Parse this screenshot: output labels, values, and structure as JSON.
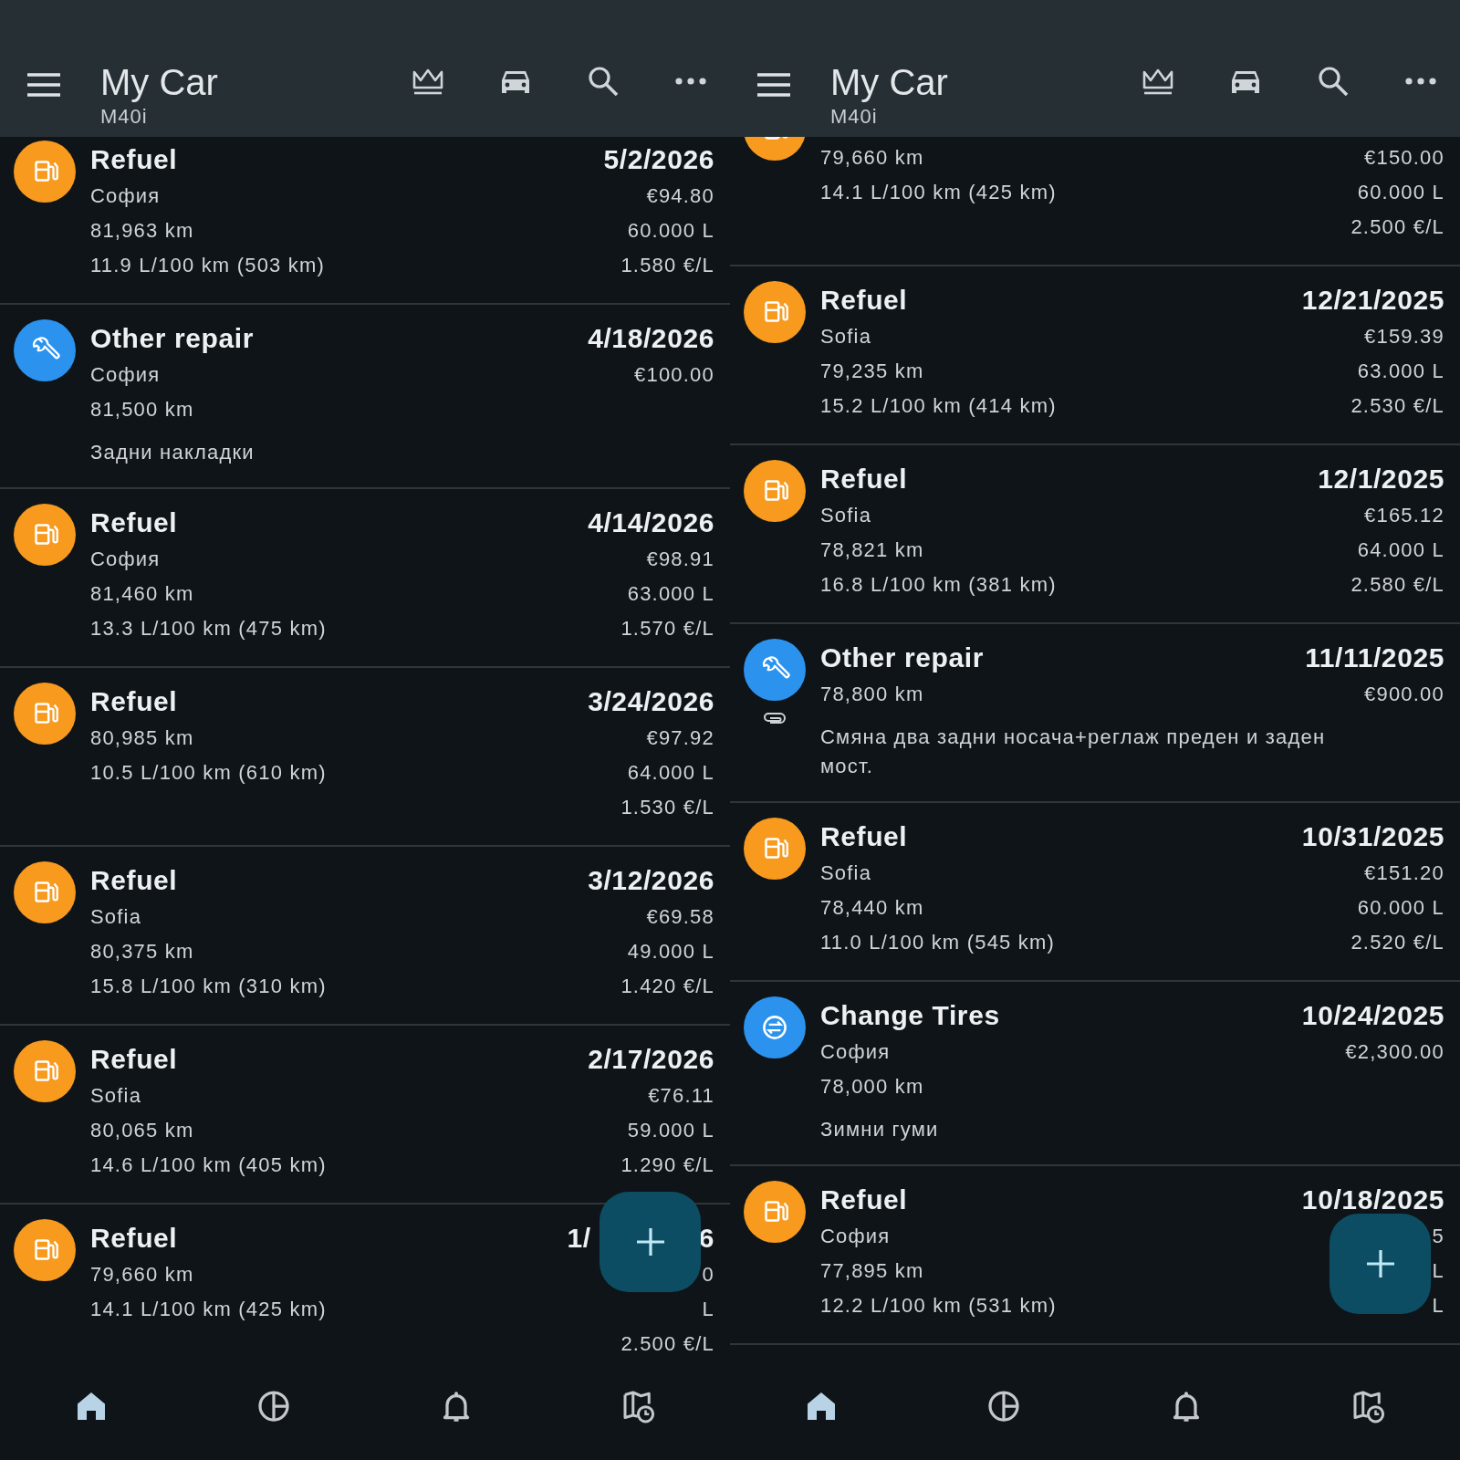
{
  "panels": [
    {
      "app_bar": {
        "title": "My Car",
        "subtitle": "M40i"
      },
      "entries": [
        {
          "kind": "refuel",
          "title": "Refuel",
          "date": "5/2/2026",
          "details": [
            "София",
            "81,963 km",
            "11.9 L/100 km (503 km)"
          ],
          "amounts": [
            "€94.80",
            "60.000 L",
            "1.580 €/L"
          ]
        },
        {
          "kind": "repair",
          "title": "Other repair",
          "date": "4/18/2026",
          "details": [
            "София",
            "81,500 km"
          ],
          "amounts": [
            "€100.00"
          ],
          "note": "Задни накладки"
        },
        {
          "kind": "refuel",
          "title": "Refuel",
          "date": "4/14/2026",
          "details": [
            "София",
            "81,460 km",
            "13.3 L/100 km (475 km)"
          ],
          "amounts": [
            "€98.91",
            "63.000 L",
            "1.570 €/L"
          ]
        },
        {
          "kind": "refuel",
          "title": "Refuel",
          "date": "3/24/2026",
          "details": [
            "80,985 km",
            "10.5 L/100 km (610 km)"
          ],
          "amounts": [
            "€97.92",
            "64.000 L",
            "1.530 €/L"
          ]
        },
        {
          "kind": "refuel",
          "title": "Refuel",
          "date": "3/12/2026",
          "details": [
            "Sofia",
            "80,375 km",
            "15.8 L/100 km (310 km)"
          ],
          "amounts": [
            "€69.58",
            "49.000 L",
            "1.420 €/L"
          ]
        },
        {
          "kind": "refuel",
          "title": "Refuel",
          "date": "2/17/2026",
          "details": [
            "Sofia",
            "80,065 km",
            "14.6 L/100 km (405 km)"
          ],
          "amounts": [
            "€76.11",
            "59.000 L",
            "1.290 €/L"
          ]
        },
        {
          "kind": "refuel",
          "title": "Refuel",
          "date": [
            "1/",
            "6"
          ],
          "details": [
            "79,660 km",
            "14.1 L/100 km (425 km)"
          ],
          "amounts": [
            "0",
            "L",
            "2.500 €/L"
          ]
        }
      ],
      "nav": [
        {
          "kind": "home",
          "selected": true
        },
        {
          "kind": "chart",
          "selected": false
        },
        {
          "kind": "bell",
          "selected": false
        },
        {
          "kind": "map",
          "selected": false
        }
      ]
    },
    {
      "app_bar": {
        "title": "My Car",
        "subtitle": "M40i"
      },
      "entries": [
        {
          "kind": "refuel",
          "details": [
            "79,660 km",
            "14.1 L/100 km (425 km)"
          ],
          "amounts": [
            "€150.00",
            "60.000 L",
            "2.500 €/L"
          ]
        },
        {
          "kind": "refuel",
          "title": "Refuel",
          "date": "12/21/2025",
          "details": [
            "Sofia",
            "79,235 km",
            "15.2 L/100 km (414 km)"
          ],
          "amounts": [
            "€159.39",
            "63.000 L",
            "2.530 €/L"
          ]
        },
        {
          "kind": "refuel",
          "title": "Refuel",
          "date": "12/1/2025",
          "details": [
            "Sofia",
            "78,821 km",
            "16.8 L/100 km (381 km)"
          ],
          "amounts": [
            "€165.12",
            "64.000 L",
            "2.580 €/L"
          ]
        },
        {
          "kind": "repair",
          "title": "Other repair",
          "date": "11/11/2025",
          "details": [
            "78,800 km"
          ],
          "amounts": [
            "€900.00"
          ],
          "note": "Смяна два задни носача+реглаж преден и заден мост.",
          "attachment": true
        },
        {
          "kind": "refuel",
          "title": "Refuel",
          "date": "10/31/2025",
          "details": [
            "Sofia",
            "78,440 km",
            "11.0 L/100 km (545 km)"
          ],
          "amounts": [
            "€151.20",
            "60.000 L",
            "2.520 €/L"
          ]
        },
        {
          "kind": "tires",
          "title": "Change Tires",
          "date": "10/24/2025",
          "details": [
            "София",
            "78,000 km"
          ],
          "amounts": [
            "€2,300.00"
          ],
          "note": "Зимни гуми"
        },
        {
          "kind": "refuel",
          "title": "Refuel",
          "date": "10/18/2025",
          "details": [
            "София",
            "77,895 km",
            "12.2 L/100 km (531 km)"
          ],
          "amounts": [
            "5",
            "L",
            "L"
          ]
        }
      ],
      "nav": [
        {
          "kind": "home",
          "selected": true
        },
        {
          "kind": "chart",
          "selected": false
        },
        {
          "kind": "bell",
          "selected": false
        },
        {
          "kind": "map",
          "selected": false
        }
      ]
    }
  ]
}
